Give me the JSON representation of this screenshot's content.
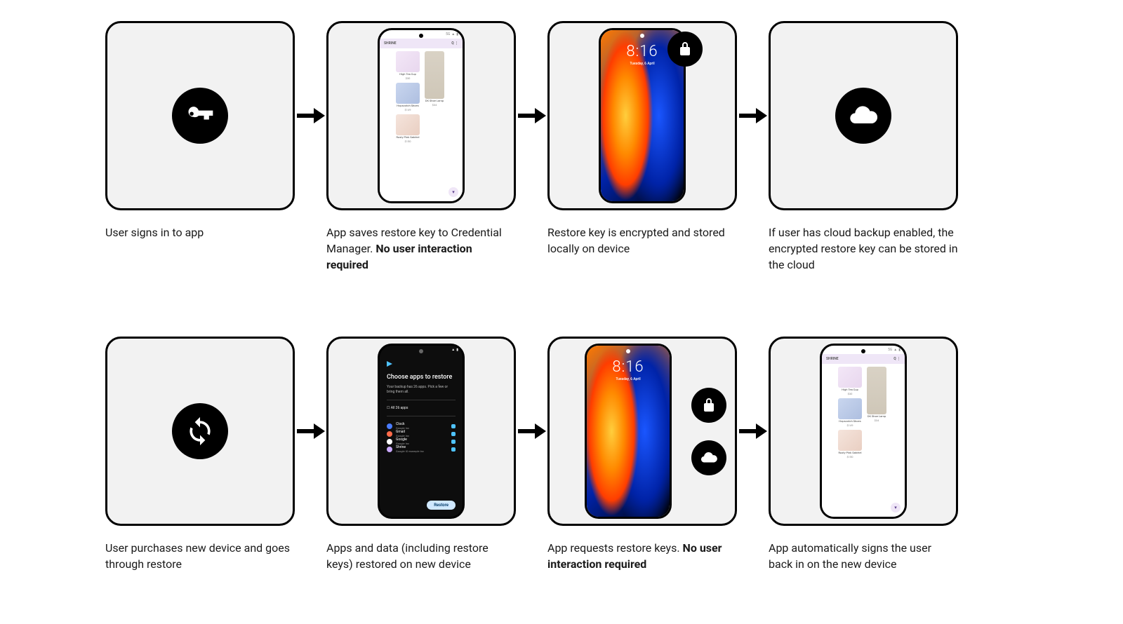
{
  "row1": {
    "step1": {
      "caption": "User signs in to app"
    },
    "step2": {
      "caption_before": "App saves restore key to Credential Manager. ",
      "caption_bold": "No user interaction required",
      "phone": {
        "status_signal": "5G",
        "appbar_left": "SHRINE",
        "appbar_right_icon1": "Q",
        "appbar_right_icon2": "⋮",
        "products": {
          "p1": {
            "name": "High Tea Cup",
            "price": "$30"
          },
          "p2": {
            "name": "Hopscotch Shoes",
            "price": "$149"
          },
          "p3": {
            "name": "Rusty Pink Satchel",
            "price": "$150"
          },
          "side": {
            "name": "DK Shoe Lamp",
            "price": "$34"
          }
        },
        "fab": "▾"
      }
    },
    "step3": {
      "caption": "Restore key is encrypted and stored locally on device",
      "clock_time": "8:16",
      "clock_date": "Tuesday, 6 April"
    },
    "step4": {
      "caption": "If user has cloud backup enabled, the encrypted restore key can be stored in the cloud"
    }
  },
  "row2": {
    "step1": {
      "caption": "User purchases new device and goes through restore"
    },
    "step2": {
      "caption": "Apps and data (including restore keys) restored on new device",
      "phone": {
        "title": "Choose apps to restore",
        "sub": "Your backup has 26 apps. Pick a few or bring them all.",
        "all_label": "All 26 apps",
        "apps": [
          {
            "name": "Clock",
            "sub": "Google Inc",
            "dot": "#4a7cff"
          },
          {
            "name": "Gmail",
            "sub": "Google Inc",
            "dot": "#ff6b4a"
          },
          {
            "name": "Google",
            "sub": "Google Inc",
            "dot": "#ffffff"
          },
          {
            "name": "Shrine",
            "sub": "Google IO example Inc",
            "dot": "#caa9ff"
          }
        ],
        "button": "Restore"
      }
    },
    "step3": {
      "caption_before": "App requests restore keys. ",
      "caption_bold": "No user interaction required",
      "clock_time": "8:16",
      "clock_date": "Tuesday, 6 April"
    },
    "step4": {
      "caption": "App automatically signs the user back in on the new device"
    }
  }
}
